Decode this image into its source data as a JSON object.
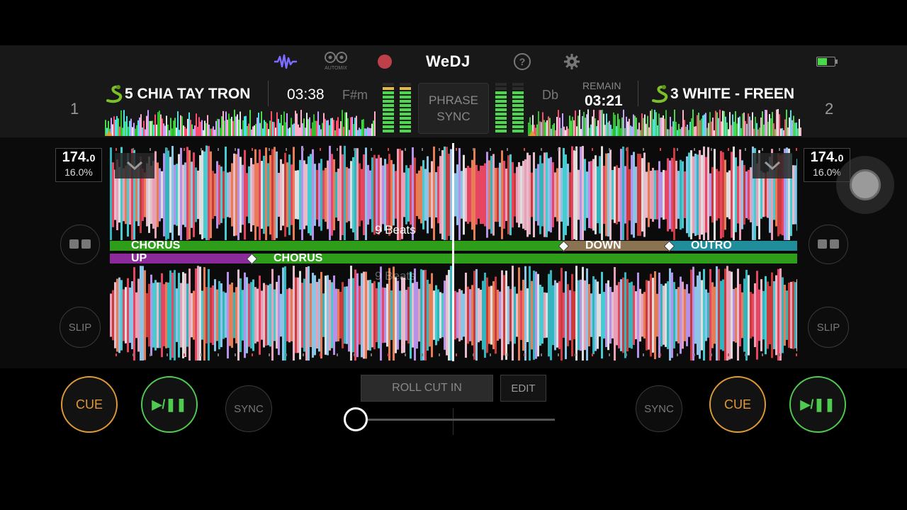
{
  "header": {
    "logo": "WeDJ",
    "automix_label": "AUTOMIX",
    "icons": [
      "waveform-icon",
      "automix-icon",
      "record-icon",
      "help-icon",
      "settings-icon",
      "battery-icon"
    ],
    "colors": {
      "waveform_icon": "#7c6cff",
      "record": "#c0404a",
      "battery": "#4bd94b"
    }
  },
  "deck1": {
    "number": "1",
    "title": "5 CHIA TAY TRON",
    "time": "03:38",
    "key": "F#m",
    "bpm_main": "174.",
    "bpm_dec": "0",
    "pitch": "16.0%",
    "cue_label": "CUE",
    "play_label": "▶/❚❚",
    "sync_label": "SYNC",
    "slip_label": "SLIP"
  },
  "deck2": {
    "number": "2",
    "title": "3 WHITE - FREEN",
    "remain_label": "REMAIN",
    "time": "03:21",
    "key": "Db",
    "bpm_main": "174.",
    "bpm_dec": "0",
    "pitch": "16.0%",
    "cue_label": "CUE",
    "play_label": "▶/❚❚",
    "sync_label": "SYNC",
    "slip_label": "SLIP"
  },
  "center": {
    "phrase_line1": "PHRASE",
    "phrase_line2": "SYNC",
    "beats_top": "9 Beats",
    "beats_bottom": "9 Beats",
    "roll_label": "ROLL CUT IN",
    "edit_label": "EDIT",
    "crossfader_value": 0
  },
  "phrases_top": [
    {
      "label": "CHORUS",
      "color": "#2e9e1a"
    },
    {
      "label": "DOWN",
      "color": "#8a7350"
    },
    {
      "label": "OUTRO",
      "color": "#1f8e9a"
    }
  ],
  "phrases_bottom": [
    {
      "label": "UP",
      "color": "#8b2a9b"
    },
    {
      "label": "CHORUS",
      "color": "#2e9e1a"
    }
  ]
}
